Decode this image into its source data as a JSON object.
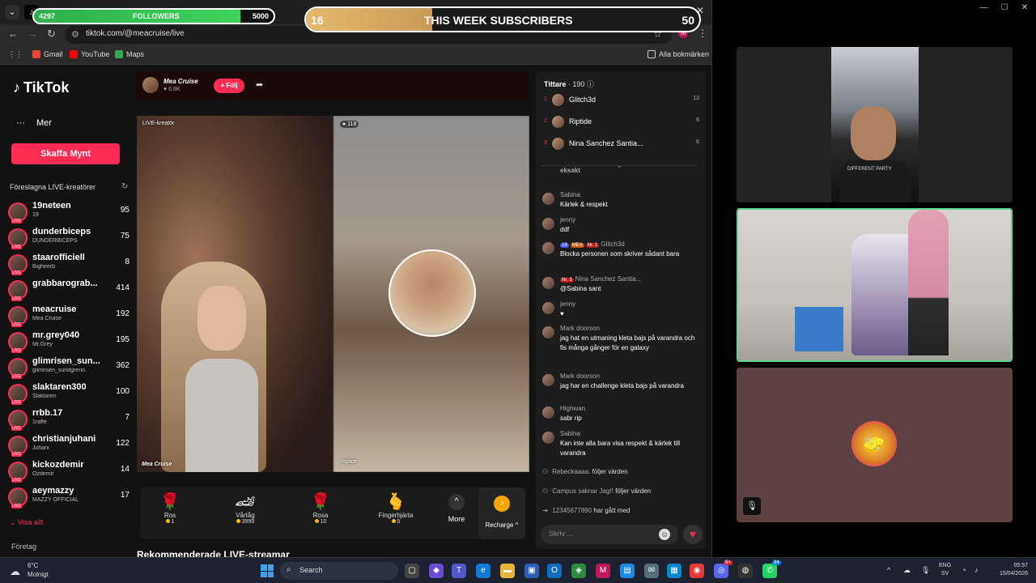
{
  "overlay": {
    "followers": {
      "current": "4297",
      "label": "FOLLOWERS",
      "goal": "5000",
      "progress": 0.86
    },
    "subscribers": {
      "current": "16",
      "label": "THIS WEEK SUBSCRIBERS",
      "goal": "50",
      "progress": 0.32
    }
  },
  "browser": {
    "url": "tiktok.com/@meacruise/live",
    "bookmarks": [
      "Gmail",
      "YouTube",
      "Maps"
    ],
    "all_bookmarks": "Alla bokmärken",
    "profile_initial": "M"
  },
  "sidebar": {
    "logo": "TikTok",
    "more": "Mer",
    "coins_button": "Skaffa Mynt",
    "suggested_title": "Föreslagna LIVE-kreatörer",
    "creators": [
      {
        "name": "19neteen",
        "sub": "19",
        "count": "95"
      },
      {
        "name": "dunderbiceps",
        "sub": "DUNDERBICEPS",
        "count": "75"
      },
      {
        "name": "staarofficiell",
        "sub": "Bigheerb",
        "count": "8"
      },
      {
        "name": "grabbarograb...",
        "sub": "",
        "count": "414"
      },
      {
        "name": "meacruise",
        "sub": "Mea Cruise",
        "count": "192"
      },
      {
        "name": "mr.grey040",
        "sub": "Mr.Grey",
        "count": "195"
      },
      {
        "name": "glimrisen_sun...",
        "sub": "glimrisen_sundgrenn",
        "count": "362"
      },
      {
        "name": "slaktaren300",
        "sub": "Slaktaren",
        "count": "100"
      },
      {
        "name": "rrbb.17",
        "sub": "1raffe",
        "count": "7"
      },
      {
        "name": "christianjuhani",
        "sub": "Juhani",
        "count": "122"
      },
      {
        "name": "kickozdemir",
        "sub": "Ozdemir",
        "count": "14"
      },
      {
        "name": "aeymazzy",
        "sub": "MAZZY OFFICIAL",
        "count": "17"
      }
    ],
    "see_all": "Visa allt",
    "company": "Företag"
  },
  "stream": {
    "host_name": "Mea Cruise",
    "likes": "6.8K",
    "follow": "+ Följ",
    "live_creator_label": "LIVE-kreatör",
    "viewer_badge": "118",
    "left_name": "Mea Cruise",
    "right_name": "Riptide"
  },
  "gifts": [
    {
      "icon": "🌹",
      "name": "Ros",
      "price": "1"
    },
    {
      "icon": "🏎",
      "name": "Vårtåg",
      "price": "3999"
    },
    {
      "icon": "🌹",
      "name": "Rosa",
      "price": "10"
    },
    {
      "icon": "🫰",
      "name": "Fingerhjärta",
      "price": "5"
    }
  ],
  "gift_more": "More",
  "recharge": "Recharge",
  "recommended": "Rekommenderade LIVE-streamar",
  "chat": {
    "viewers_label": "Tittare",
    "viewers_count": "· 190",
    "top_viewers": [
      {
        "rank": "1",
        "name": "Glitch3d",
        "score": "13"
      },
      {
        "rank": "2",
        "name": "Riptide",
        "score": "6"
      },
      {
        "rank": "3",
        "name": "Nina Sanchez Santia...",
        "score": "6"
      }
    ],
    "messages": [
      {
        "name": "",
        "text": "eksakt"
      },
      {
        "name": "Sabina",
        "text": "Kärlek & respekt"
      },
      {
        "name": "jenny",
        "text": "ddf"
      },
      {
        "name": "Glitch3d",
        "text": "Blocka personen som skriver sådant bara",
        "badges": [
          "19",
          "MEA",
          "Nr. 1"
        ]
      },
      {
        "name": "Nina Sanchez Santia...",
        "text": "@Sabina sant",
        "badges": [
          "Nr. 3"
        ]
      },
      {
        "name": "jenny",
        "text": "♥"
      },
      {
        "name": "Mark doorson",
        "text": "jag hat en utmaning kleta bajs på varandra och fis många gånger för en galaxy"
      },
      {
        "name": "Mark doorson",
        "text": "jag har en challenge kleta bajs på varandra"
      },
      {
        "name": "Highwan",
        "text": "sabr rip"
      },
      {
        "name": "Sabina",
        "text": "Kan inte alla bara visa respekt & kärlek till varandra"
      }
    ],
    "system": [
      {
        "name": "Rebeckaaaa.",
        "text": "följer värden"
      },
      {
        "name": "Campus saknar Jag!!",
        "text": "följer värden"
      },
      {
        "name": "12345677890",
        "text": "har gått med"
      }
    ],
    "input_placeholder": "Skriv ..."
  },
  "right_panels": {
    "shirt_text": "DIFFERENT PARTY"
  },
  "taskbar": {
    "temp": "6°C",
    "weather": "Molnigt",
    "search": "Search",
    "lang_top": "ENG",
    "lang_bottom": "SV",
    "time": "05:57",
    "date": "15/04/2026",
    "badge_discord": "9+",
    "badge_whatsapp": "34"
  },
  "colors": {
    "accent": "#fe2c55",
    "followers_fill": "#3fd35a",
    "subs_fill": "#d8a862"
  }
}
